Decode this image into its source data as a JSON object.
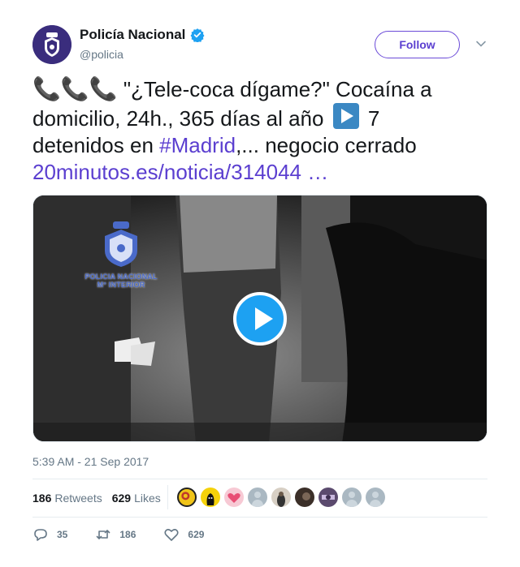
{
  "author": {
    "display_name": "Policía Nacional",
    "handle": "@policia",
    "verified": true,
    "avatar_icon": "police-badge-icon"
  },
  "follow_label": "Follow",
  "tweet": {
    "line1": " \"¿Tele-coca dígame?\" Cocaína a",
    "line2_a": "domicilio, 24h., 365 días al año ",
    "line2_b": " 7",
    "line3_a": "detenidos en ",
    "hashtag": "#Madrid",
    "line3_b": ",... negocio cerrado",
    "link": " 20minutos.es/noticia/314044 …",
    "emoji_phone": "📞📞📞",
    "emoji_play": "play-button-emoji"
  },
  "video": {
    "watermark_line1": "POLICIA NACIONAL",
    "watermark_line2": "M° INTERIOR"
  },
  "timestamp": "5:39 AM - 21 Sep 2017",
  "stats": {
    "retweets_count": "186",
    "retweets_label": "Retweets",
    "likes_count": "629",
    "likes_label": "Likes"
  },
  "actions": {
    "replies": "35",
    "retweets": "186",
    "likes": "629"
  },
  "colors": {
    "accent": "#5b3fd0",
    "verified": "#1da1f2",
    "muted": "#657786"
  }
}
